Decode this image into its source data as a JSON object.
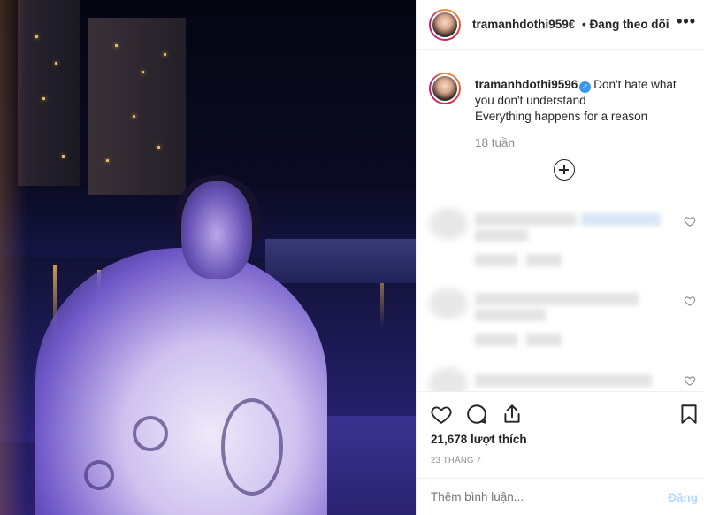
{
  "post": {
    "username": "tramanhdothi9596",
    "header_username": "tramanhdothi959€",
    "separator": "•",
    "follow_status": "Đang theo dõi",
    "more": "•••",
    "caption": {
      "username": "tramanhdothi9596",
      "verified": "✓",
      "line1": "Don't hate what",
      "line2": "you don't understand",
      "line3": "Everything happens for a reason"
    },
    "time_ago": "18 tuần",
    "likes": "21,678 lượt thích",
    "date": "23 THÁNG 7",
    "comment_placeholder": "Thêm bình luận...",
    "post_label": "Đăng"
  },
  "icons": {
    "more": "more-icon",
    "like": "heart-icon",
    "comment": "comment-icon",
    "share": "share-icon",
    "save": "bookmark-icon",
    "load_more": "plus-circle-icon",
    "comment_like": "heart-outline-icon"
  },
  "colors": {
    "text": "#262626",
    "muted": "#8e8e8e",
    "verified": "#3897f0",
    "post_disabled": "#b3dbff",
    "border": "#efefef"
  }
}
